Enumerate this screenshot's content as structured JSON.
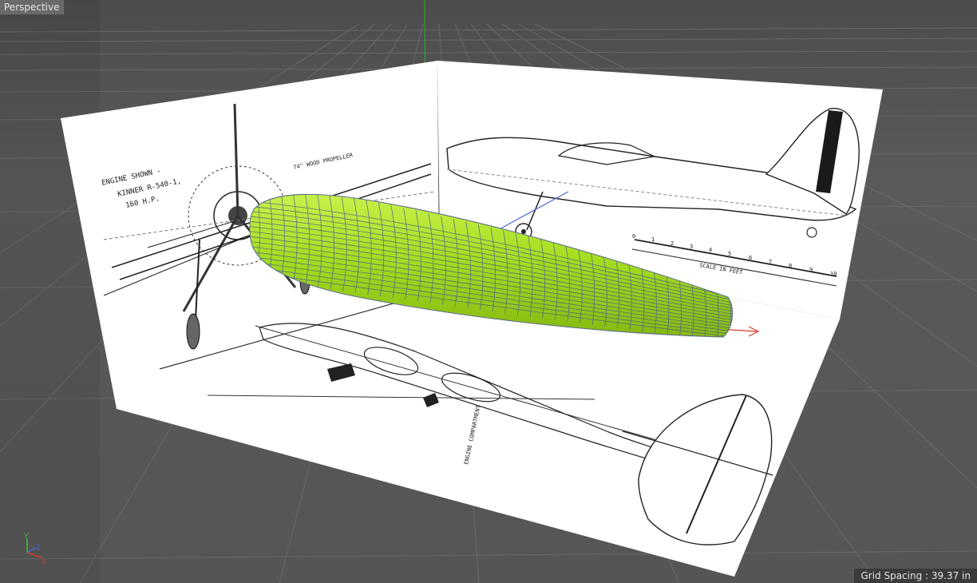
{
  "viewport": {
    "name": "Perspective",
    "grid_spacing_text": "Grid Spacing : 39.37 in"
  },
  "axis_gizmo": {
    "x_label": "X",
    "y_label": "Y",
    "z_label": "Z",
    "x_color": "#d23a2a",
    "y_color": "#3fbf3f",
    "z_color": "#4a6ad8"
  },
  "blueprint": {
    "engine_note_line1": "ENGINE SHOWN -",
    "engine_note_line2": "KINNER R-540-1,",
    "engine_note_line3": "160 H.P.",
    "propeller_note": "74\" WOOD PROPELLER",
    "scale_label": "SCALE IN FEET",
    "scale_ticks": [
      "0",
      "1",
      "2",
      "3",
      "4",
      "5",
      "6",
      "7",
      "8",
      "9",
      "10"
    ],
    "compartment_label": "ENGINE COMPARTMENT"
  },
  "colors": {
    "background": "#575757",
    "grid_line": "#6e6e6e",
    "fuselage_fill": "#a6dd1f",
    "fuselage_mesh": "#5a6a9a",
    "blueprint_paper": "#ffffff"
  }
}
